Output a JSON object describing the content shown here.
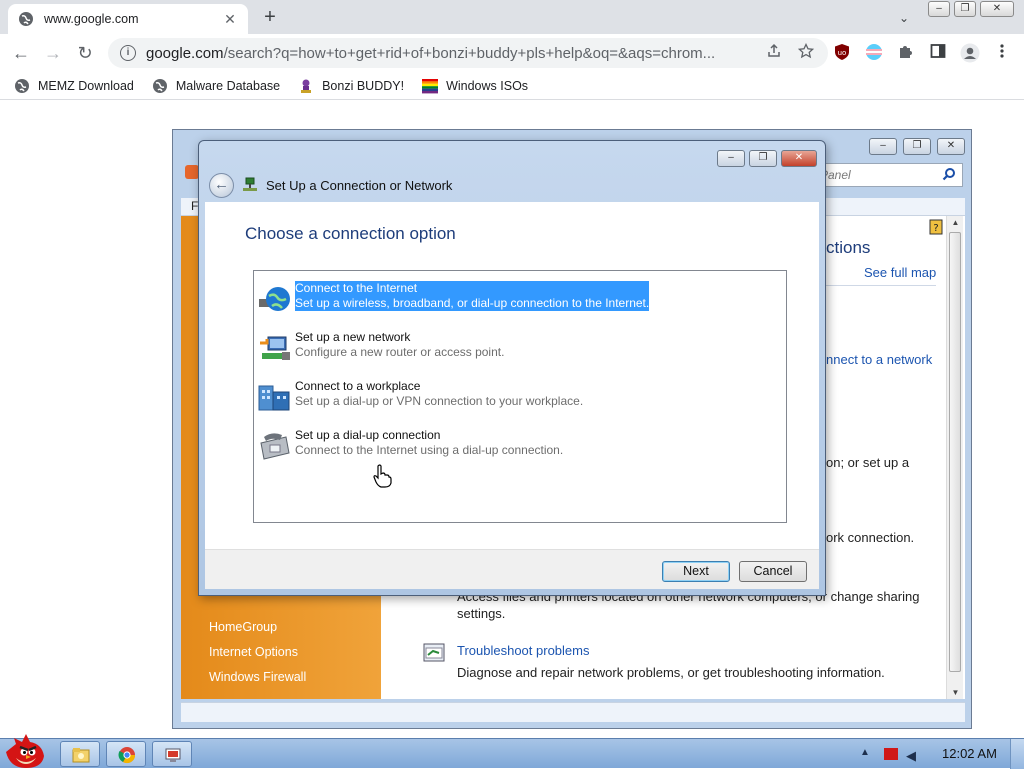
{
  "browser": {
    "tab_title": "www.google.com",
    "tab_close": "✕",
    "new_tab": "+",
    "tab_search": "⌄",
    "window_buttons": [
      "–",
      "❐",
      "✕"
    ],
    "url_host": "google.com",
    "url_rest": "/search?q=how+to+get+rid+of+bonzi+buddy+pls+help&oq=&aqs=chrom...",
    "nav": {
      "back": "←",
      "forward": "→",
      "reload": "↻",
      "info": "i"
    },
    "bookmarks": [
      {
        "label": "MEMZ Download",
        "icon": "globe-icon"
      },
      {
        "label": "Malware Database",
        "icon": "globe-icon"
      },
      {
        "label": "Bonzi BUDDY!",
        "icon": "bonzi-icon"
      },
      {
        "label": "Windows ISOs",
        "icon": "windows-flag-icon"
      }
    ]
  },
  "control_panel": {
    "search_placeholder": "Panel",
    "menu_first": "F",
    "heading_partial": "ctions",
    "see_full_map": "See full map",
    "connect_link_partial": "nnect to a network",
    "text_setup_partial": "on; or set up a",
    "text_network_conn_partial": "ork connection.",
    "text_access_files": "Access files and printers located on other network computers, or change sharing",
    "text_settings": "settings.",
    "troubleshoot_link": "Troubleshoot problems",
    "troubleshoot_desc": "Diagnose and repair network problems, or get troubleshooting information.",
    "sidebar_links": [
      "HomeGroup",
      "Internet Options",
      "Windows Firewall"
    ]
  },
  "dialog": {
    "title": "Set Up a Connection or Network",
    "heading": "Choose a connection option",
    "options": [
      {
        "title": "Connect to the Internet",
        "desc": "Set up a wireless, broadband, or dial-up connection to the Internet.",
        "selected": true
      },
      {
        "title": "Set up a new network",
        "desc": "Configure a new router or access point.",
        "selected": false
      },
      {
        "title": "Connect to a workplace",
        "desc": "Set up a dial-up or VPN connection to your workplace.",
        "selected": false
      },
      {
        "title": "Set up a dial-up connection",
        "desc": "Connect to the Internet using a dial-up connection.",
        "selected": false
      }
    ],
    "next_label": "Next",
    "cancel_label": "Cancel",
    "back_glyph": "←"
  },
  "taskbar": {
    "clock": "12:02 AM",
    "tray_up": "▲",
    "volume": "◀"
  }
}
